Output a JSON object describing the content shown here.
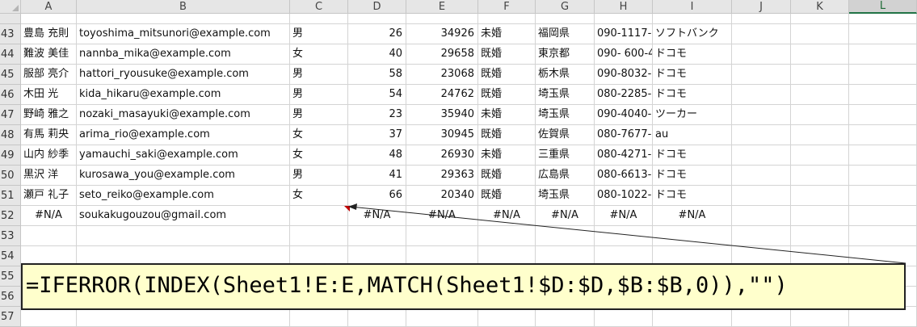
{
  "columns": [
    {
      "label": "A"
    },
    {
      "label": "B"
    },
    {
      "label": "C"
    },
    {
      "label": "D"
    },
    {
      "label": "E"
    },
    {
      "label": "F"
    },
    {
      "label": "G"
    },
    {
      "label": "H"
    },
    {
      "label": "I"
    },
    {
      "label": "J"
    },
    {
      "label": "K"
    },
    {
      "label": "L"
    }
  ],
  "selected_column": "L",
  "rows": [
    {
      "num": "43",
      "cells": [
        "豊島 充則",
        "toyoshima_mitsunori@example.com",
        "男",
        "26",
        "34926",
        "未婚",
        "福岡県",
        "090-1117-",
        "ソフトバンク",
        "",
        "",
        ""
      ]
    },
    {
      "num": "44",
      "cells": [
        "難波 美佳",
        "nannba_mika@example.com",
        "女",
        "40",
        "29658",
        "既婚",
        "東京都",
        "090- 600-4",
        "ドコモ",
        "",
        "",
        ""
      ]
    },
    {
      "num": "45",
      "cells": [
        "服部 亮介",
        "hattori_ryousuke@example.com",
        "男",
        "58",
        "23068",
        "既婚",
        "栃木県",
        "090-8032-",
        "ドコモ",
        "",
        "",
        ""
      ]
    },
    {
      "num": "46",
      "cells": [
        "木田 光",
        "kida_hikaru@example.com",
        "男",
        "54",
        "24762",
        "既婚",
        "埼玉県",
        "080-2285-",
        "ドコモ",
        "",
        "",
        ""
      ]
    },
    {
      "num": "47",
      "cells": [
        "野崎 雅之",
        "nozaki_masayuki@example.com",
        "男",
        "23",
        "35940",
        "未婚",
        "埼玉県",
        "090-4040-",
        "ツーカー",
        "",
        "",
        ""
      ]
    },
    {
      "num": "48",
      "cells": [
        "有馬 莉央",
        "arima_rio@example.com",
        "女",
        "37",
        "30945",
        "既婚",
        "佐賀県",
        "080-7677-",
        "au",
        "",
        "",
        ""
      ]
    },
    {
      "num": "49",
      "cells": [
        "山内 紗季",
        "yamauchi_saki@example.com",
        "女",
        "48",
        "26930",
        "未婚",
        "三重県",
        "080-4271-",
        "ドコモ",
        "",
        "",
        ""
      ]
    },
    {
      "num": "50",
      "cells": [
        "黒沢 洋",
        "kurosawa_you@example.com",
        "男",
        "41",
        "29363",
        "既婚",
        "広島県",
        "080-6613-",
        "ドコモ",
        "",
        "",
        ""
      ]
    },
    {
      "num": "51",
      "cells": [
        "瀬戸 礼子",
        "seto_reiko@example.com",
        "女",
        "66",
        "20340",
        "既婚",
        "埼玉県",
        "080-1022-",
        "ドコモ",
        "",
        "",
        ""
      ]
    },
    {
      "num": "52",
      "cells": [
        "#N/A",
        "soukakugouzou@gmail.com",
        "",
        "#N/A",
        "#N/A",
        "#N/A",
        "#N/A",
        "#N/A",
        "#N/A",
        "",
        "",
        ""
      ]
    },
    {
      "num": "53",
      "cells": [
        "",
        "",
        "",
        "",
        "",
        "",
        "",
        "",
        "",
        "",
        "",
        ""
      ]
    },
    {
      "num": "54",
      "cells": [
        "",
        "",
        "",
        "",
        "",
        "",
        "",
        "",
        "",
        "",
        "",
        ""
      ]
    },
    {
      "num": "55",
      "cells": [
        "",
        "",
        "",
        "",
        "",
        "",
        "",
        "",
        "",
        "",
        "",
        ""
      ]
    },
    {
      "num": "56",
      "cells": [
        "",
        "",
        "",
        "",
        "",
        "",
        "",
        "",
        "",
        "",
        "",
        ""
      ]
    },
    {
      "num": "57",
      "cells": [
        "",
        "",
        "",
        "",
        "",
        "",
        "",
        "",
        "",
        "",
        "",
        ""
      ]
    }
  ],
  "formula_callout": "=IFERROR(INDEX(Sheet1!E:E,MATCH(Sheet1!$D:$D,$B:$B,0)),\"\")",
  "colors": {
    "comment_indicator": "#c00000",
    "callout_bg": "#ffffcc",
    "selected_header_accent": "#217346"
  }
}
